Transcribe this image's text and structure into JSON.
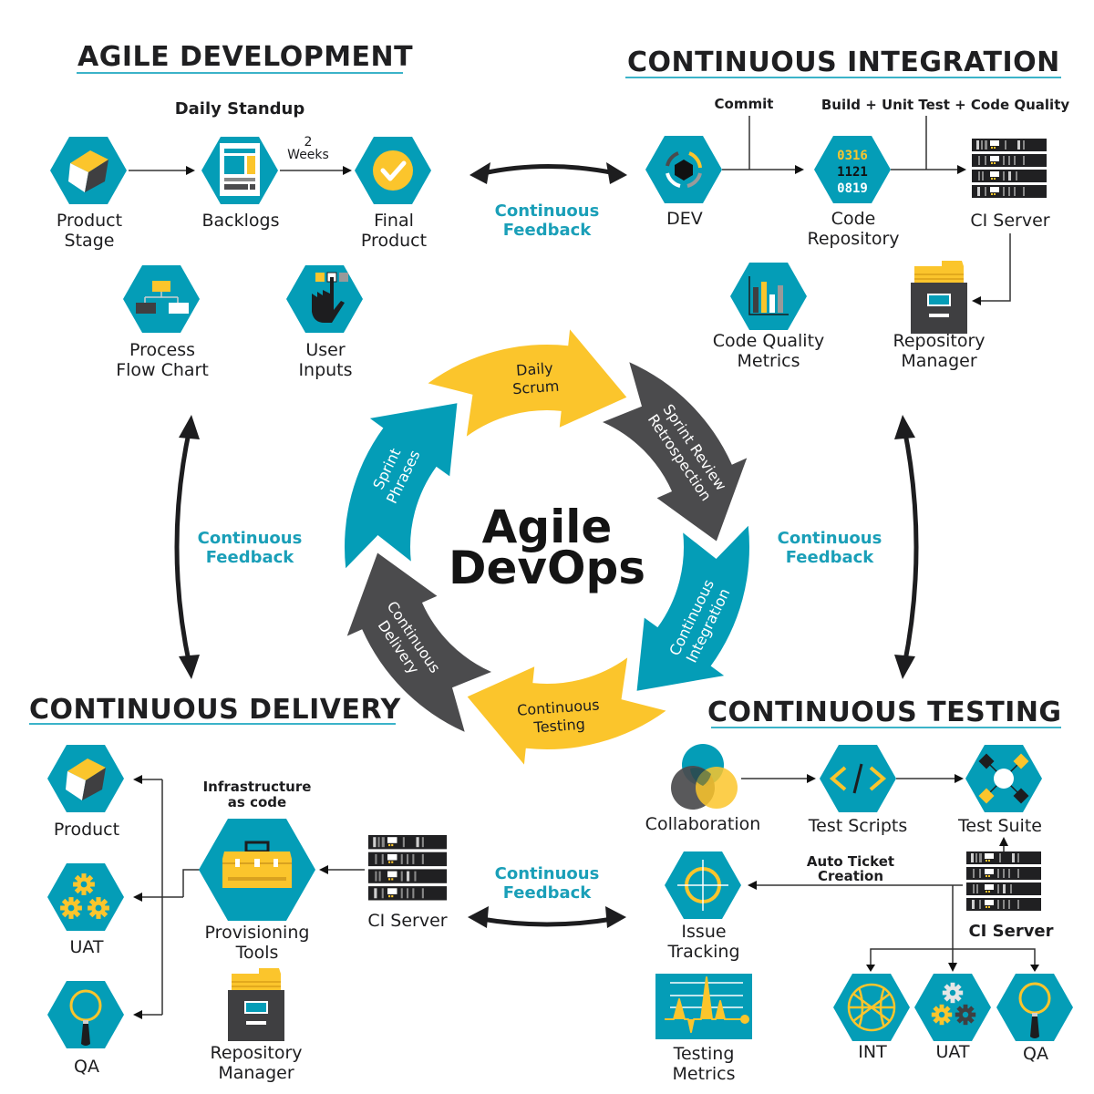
{
  "colors": {
    "teal": "#049db7",
    "yellow": "#fbc52c",
    "dark": "#4b4b4d",
    "feedback_text": "#1a9fb8",
    "title_underline": "#3bb3c9"
  },
  "center": {
    "line1": "Agile",
    "line2": "DevOps"
  },
  "cycle": [
    {
      "id": "daily-scrum",
      "line1": "Daily",
      "line2": "Scrum",
      "color": "yellow"
    },
    {
      "id": "sprint-review",
      "line1": "Sprint Review",
      "line2": "Retrospection",
      "color": "dark"
    },
    {
      "id": "continuous-integration",
      "line1": "Continuous",
      "line2": "Integration",
      "color": "teal"
    },
    {
      "id": "continuous-testing",
      "line1": "Continuous",
      "line2": "Testing",
      "color": "yellow"
    },
    {
      "id": "continuous-delivery",
      "line1": "Continuous",
      "line2": "Delivery",
      "color": "dark"
    },
    {
      "id": "sprint-phrases",
      "line1": "Sprint",
      "line2": "Phrases",
      "color": "teal"
    }
  ],
  "feedback": {
    "line1": "Continuous",
    "line2": "Feedback"
  },
  "agile_development": {
    "title": "AGILE DEVELOPMENT",
    "subtitle": "Daily Standup",
    "duration_num": "2",
    "duration_unit": "Weeks",
    "items": [
      {
        "icon": "cube-icon",
        "line1": "Product",
        "line2": "Stage"
      },
      {
        "icon": "backlog-document-icon",
        "line1": "Backlogs",
        "line2": ""
      },
      {
        "icon": "checkmark-icon",
        "line1": "Final",
        "line2": "Product"
      },
      {
        "icon": "flowchart-icon",
        "line1": "Process",
        "line2": "Flow Chart"
      },
      {
        "icon": "hand-pointer-icon",
        "line1": "User",
        "line2": "Inputs"
      }
    ]
  },
  "continuous_integration": {
    "title": "CONTINUOUS INTEGRATION",
    "commit_label": "Commit",
    "build_label": "Build + Unit Test + Code Quality",
    "code_digits": [
      "0316",
      "1121",
      "0819"
    ],
    "items": [
      {
        "icon": "dev-cycle-icon",
        "line1": "DEV",
        "line2": ""
      },
      {
        "icon": "code-repository-icon",
        "line1": "Code",
        "line2": "Repository"
      },
      {
        "icon": "server-rack-icon",
        "line1": "CI Server",
        "line2": ""
      },
      {
        "icon": "bar-chart-icon",
        "line1": "Code Quality",
        "line2": "Metrics"
      },
      {
        "icon": "file-cabinet-icon",
        "line1": "Repository",
        "line2": "Manager"
      }
    ]
  },
  "continuous_delivery": {
    "title": "CONTINUOUS DELIVERY",
    "iac_line1": "Infrastructure",
    "iac_line2": "as code",
    "items": [
      {
        "icon": "cube-icon",
        "line1": "Product",
        "line2": ""
      },
      {
        "icon": "gears-icon",
        "line1": "UAT",
        "line2": ""
      },
      {
        "icon": "magnifier-icon",
        "line1": "QA",
        "line2": ""
      },
      {
        "icon": "toolbox-icon",
        "line1": "Provisioning",
        "line2": "Tools"
      },
      {
        "icon": "server-rack-icon",
        "line1": "CI Server",
        "line2": ""
      },
      {
        "icon": "file-cabinet-icon",
        "line1": "Repository",
        "line2": "Manager"
      }
    ]
  },
  "continuous_testing": {
    "title": "CONTINUOUS TESTING",
    "ticket_line1": "Auto Ticket",
    "ticket_line2": "Creation",
    "items": [
      {
        "icon": "venn-circles-icon",
        "line1": "Collaboration",
        "line2": ""
      },
      {
        "icon": "code-brackets-icon",
        "line1": "Test Scripts",
        "line2": "",
        "glyph": "< / >"
      },
      {
        "icon": "network-nodes-icon",
        "line1": "Test Suite",
        "line2": ""
      },
      {
        "icon": "target-crosshair-icon",
        "line1": "Issue",
        "line2": "Tracking"
      },
      {
        "icon": "pulse-chart-icon",
        "line1": "Testing",
        "line2": "Metrics"
      },
      {
        "icon": "server-rack-icon",
        "line1": "CI Server",
        "line2": ""
      },
      {
        "icon": "globe-icon",
        "line1": "INT",
        "line2": ""
      },
      {
        "icon": "gears-icon",
        "line1": "UAT",
        "line2": ""
      },
      {
        "icon": "magnifier-icon",
        "line1": "QA",
        "line2": ""
      }
    ]
  }
}
